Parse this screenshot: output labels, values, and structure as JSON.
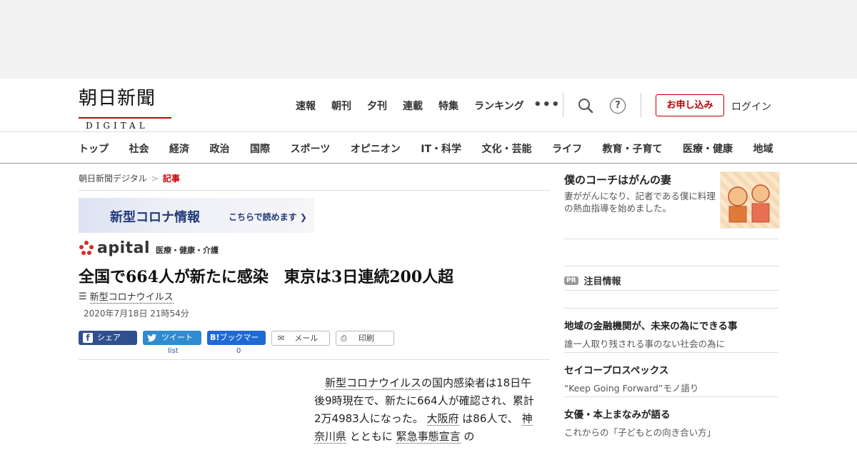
{
  "header": {
    "logo_main": "朝日新聞",
    "logo_sub": "DIGITAL",
    "top_nav": [
      "速報",
      "朝刊",
      "夕刊",
      "連載",
      "特集",
      "ランキング"
    ],
    "apply_label": "お申し込み",
    "login_label": "ログイン",
    "help_glyph": "?",
    "more_glyph": "•••",
    "categories": [
      "トップ",
      "社会",
      "経済",
      "政治",
      "国際",
      "スポーツ",
      "オピニオン",
      "IT・科学",
      "文化・芸能",
      "ライフ",
      "教育・子育て",
      "医療・健康",
      "地域"
    ]
  },
  "breadcrumb": {
    "home": "朝日新聞デジタル",
    "sep": ">",
    "current": "記事"
  },
  "banner": {
    "title": "新型コロナ情報",
    "cta": "こちらで読めます ❯"
  },
  "section": {
    "name": "apital",
    "sub": "医療・健康・介護"
  },
  "article": {
    "headline": "全国で664人が新たに感染　東京は3日連続200人超",
    "topic": "新型コロナウイルス",
    "date": "2020年7月18日 21時54分",
    "share": {
      "facebook": "シェア",
      "twitter": "ツイート",
      "hatena": "ブックマーク",
      "hatena_badge": "B!",
      "mail": "メール",
      "print": "印刷",
      "twitter_count": "list",
      "hatena_count": "0"
    },
    "body": {
      "indent": "　",
      "link1": "新型コロナウイルス",
      "text1": "の国内感染者は18日午後9時現在で、新たに664人が確認され、累計2万4983人になった。",
      "link2": "大阪府",
      "text2": "は86人で、",
      "link3": "神奈川県",
      "text3": "とともに",
      "link4": "緊急事態宣言",
      "text4": "の"
    }
  },
  "sidebar": {
    "feature": {
      "title": "僕のコーチはがんの妻",
      "desc": "妻ががんになり、記者である僕に料理の熱血指導を始めました。"
    },
    "pr_badge": "PR",
    "pr_title": "注目情報",
    "ads": [
      {
        "title": "地域の金融機関が、未来の為にできる事",
        "desc": "誰一人取り残される事のない社会の為に"
      },
      {
        "title": "セイコープロスペックス",
        "desc": "“Keep Going Forward”モノ語り"
      },
      {
        "title": "女優・本上まなみが語る",
        "desc": "これからの「子どもとの向き合い方」"
      }
    ]
  }
}
